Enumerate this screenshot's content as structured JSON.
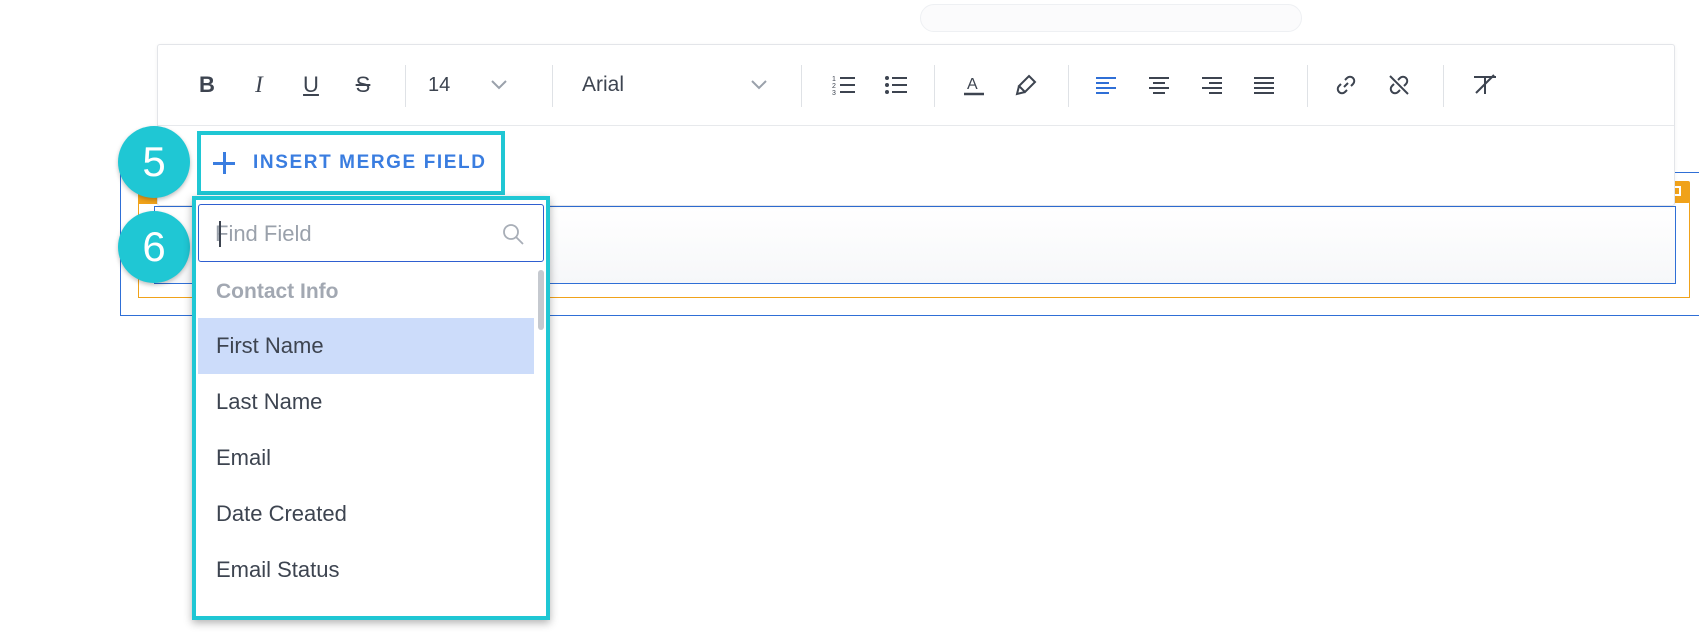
{
  "toolbar": {
    "bold": "B",
    "italic": "I",
    "underline": "U",
    "strikethrough": "S",
    "font_size": "14",
    "font_family": "Arial"
  },
  "merge": {
    "label": "INSERT MERGE FIELD"
  },
  "steps": [
    "5",
    "6"
  ],
  "dropdown": {
    "search_placeholder": "Find Field",
    "group": "Contact Info",
    "items": [
      "First Name",
      "Last Name",
      "Email",
      "Date Created",
      "Email Status"
    ],
    "selected": "First Name"
  },
  "colors": {
    "highlight": "#1fc7d4",
    "accent": "#3a7de0",
    "frame_blue": "#2f6fd6",
    "frame_orange": "#f0a21a",
    "selected_row": "#ccdcfa"
  }
}
